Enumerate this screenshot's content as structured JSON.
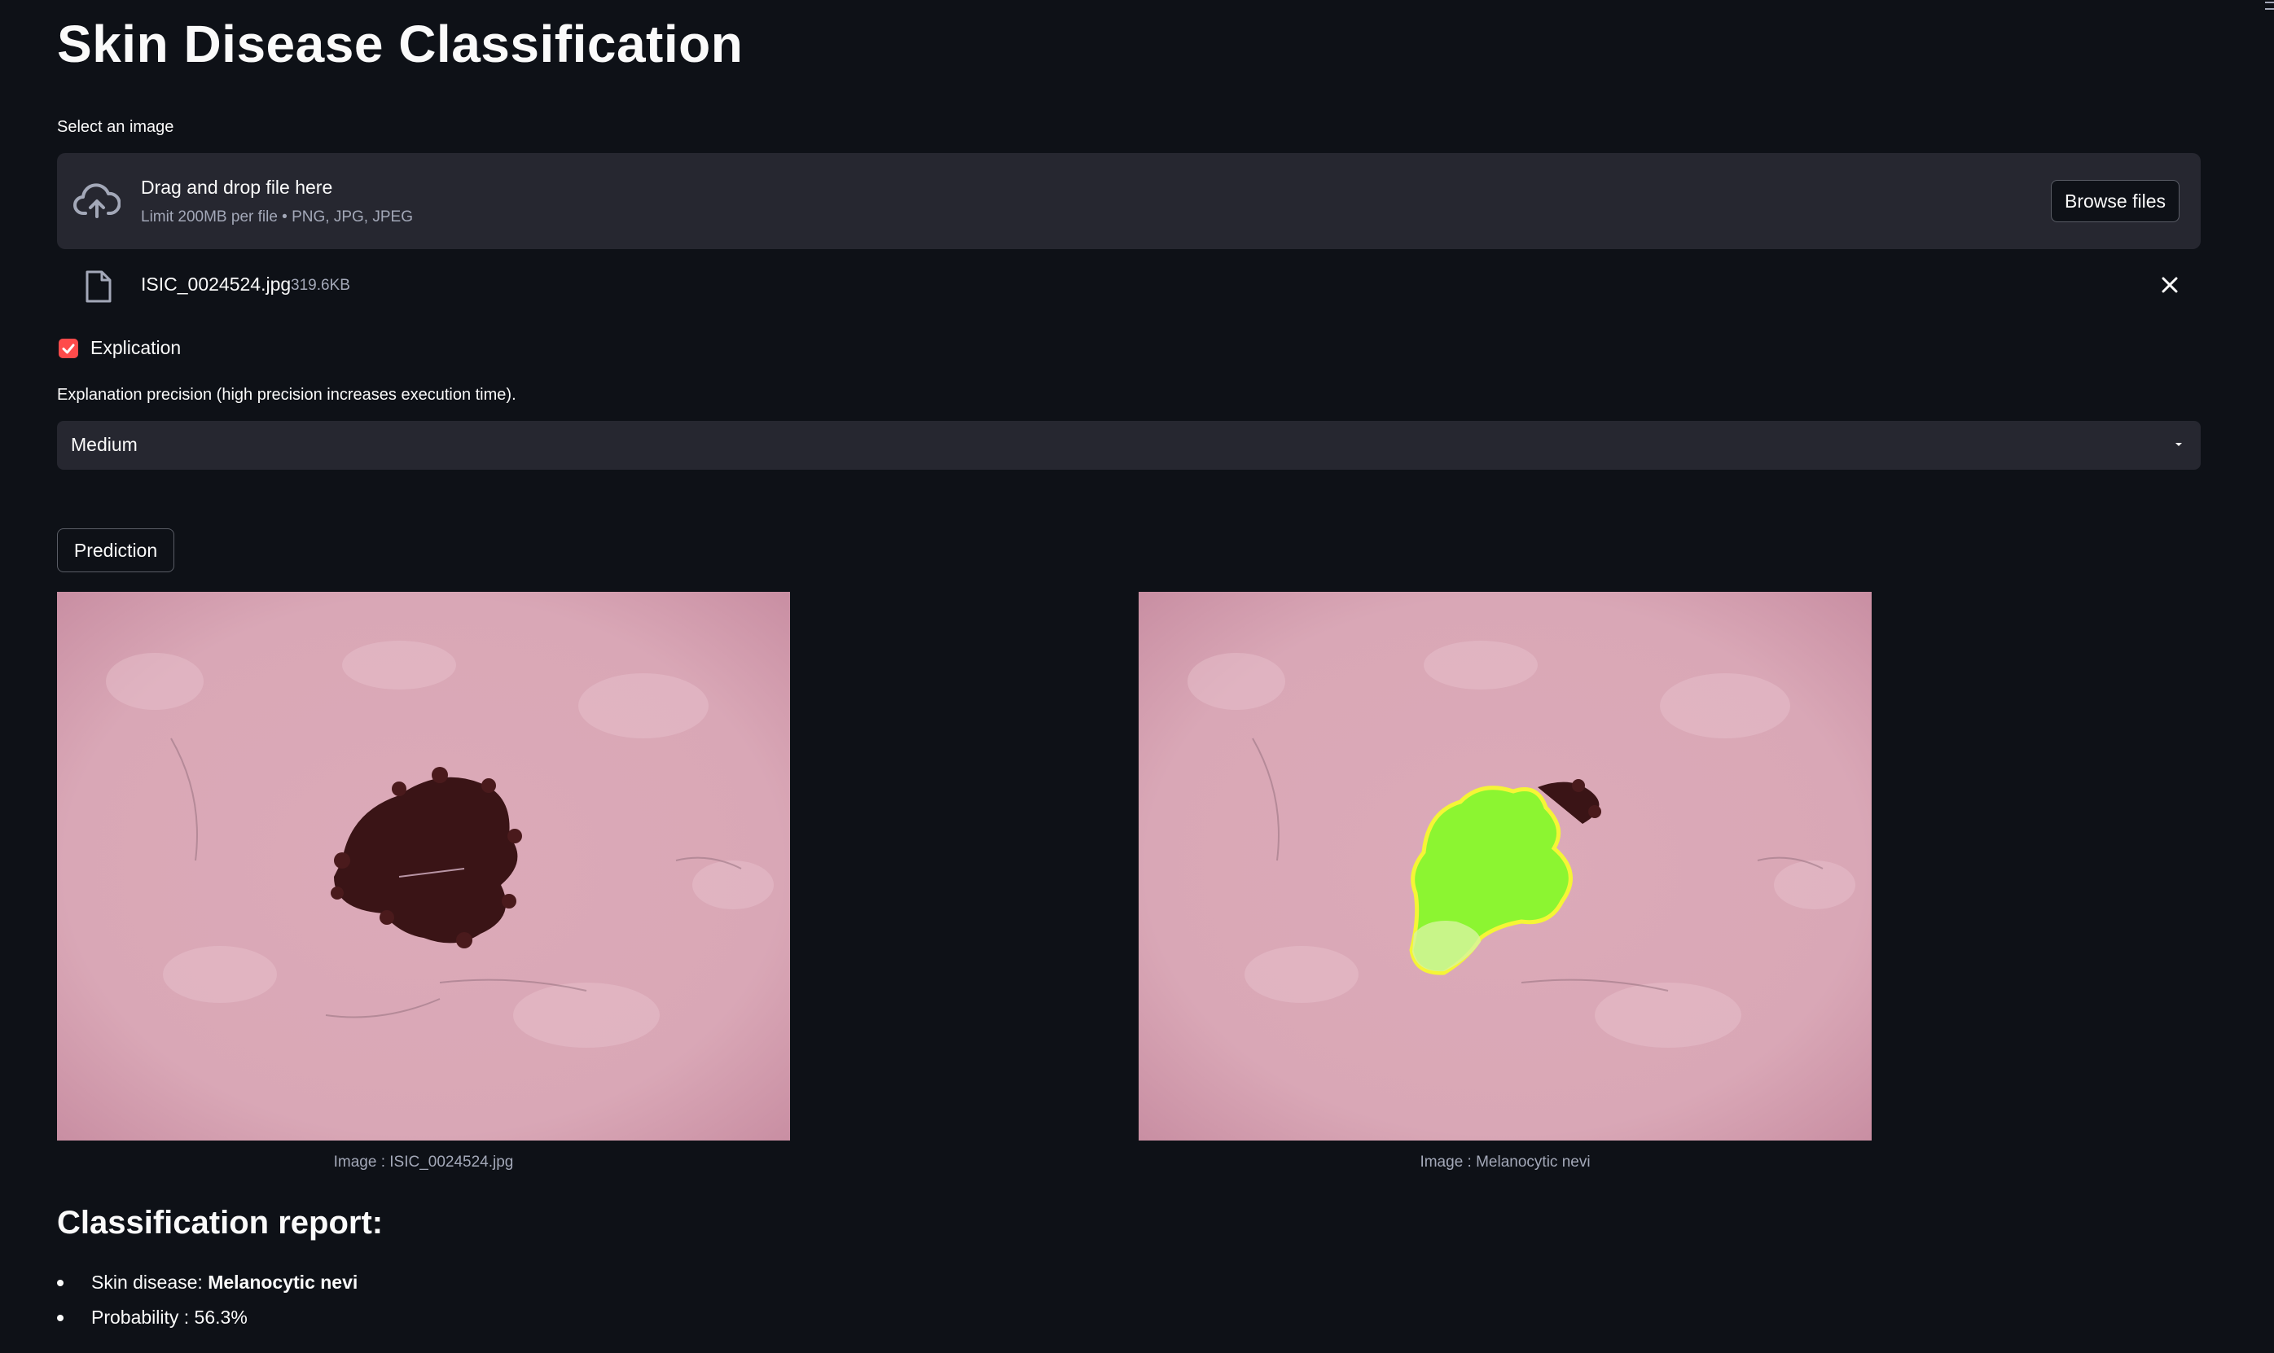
{
  "page": {
    "title": "Skin Disease Classification"
  },
  "uploader": {
    "label": "Select an image",
    "drop_title": "Drag and drop file here",
    "drop_subtitle": "Limit 200MB per file • PNG, JPG, JPEG",
    "browse_label": "Browse files",
    "icon": "cloud-upload-icon",
    "file": {
      "name": "ISIC_0024524.jpg",
      "size": "319.6KB",
      "icon": "file-icon",
      "remove_icon": "close-icon"
    }
  },
  "explication": {
    "label": "Explication",
    "checked": true
  },
  "precision": {
    "label": "Explanation precision (high precision increases execution time).",
    "value": "Medium",
    "icon": "chevron-down-icon"
  },
  "prediction_button": "Prediction",
  "images": {
    "original_caption": "Image : ISIC_0024524.jpg",
    "explained_caption": "Image : Melanocytic nevi"
  },
  "report": {
    "title": "Classification report:",
    "disease_label": "Skin disease: ",
    "disease_value": "Melanocytic nevi",
    "probability_text": "Probability : 56.3%"
  },
  "colors": {
    "background": "#0e1117",
    "surface": "#262730",
    "accent": "#ff4b4b",
    "highlight": "#8cf531",
    "outline": "#f5f536"
  }
}
